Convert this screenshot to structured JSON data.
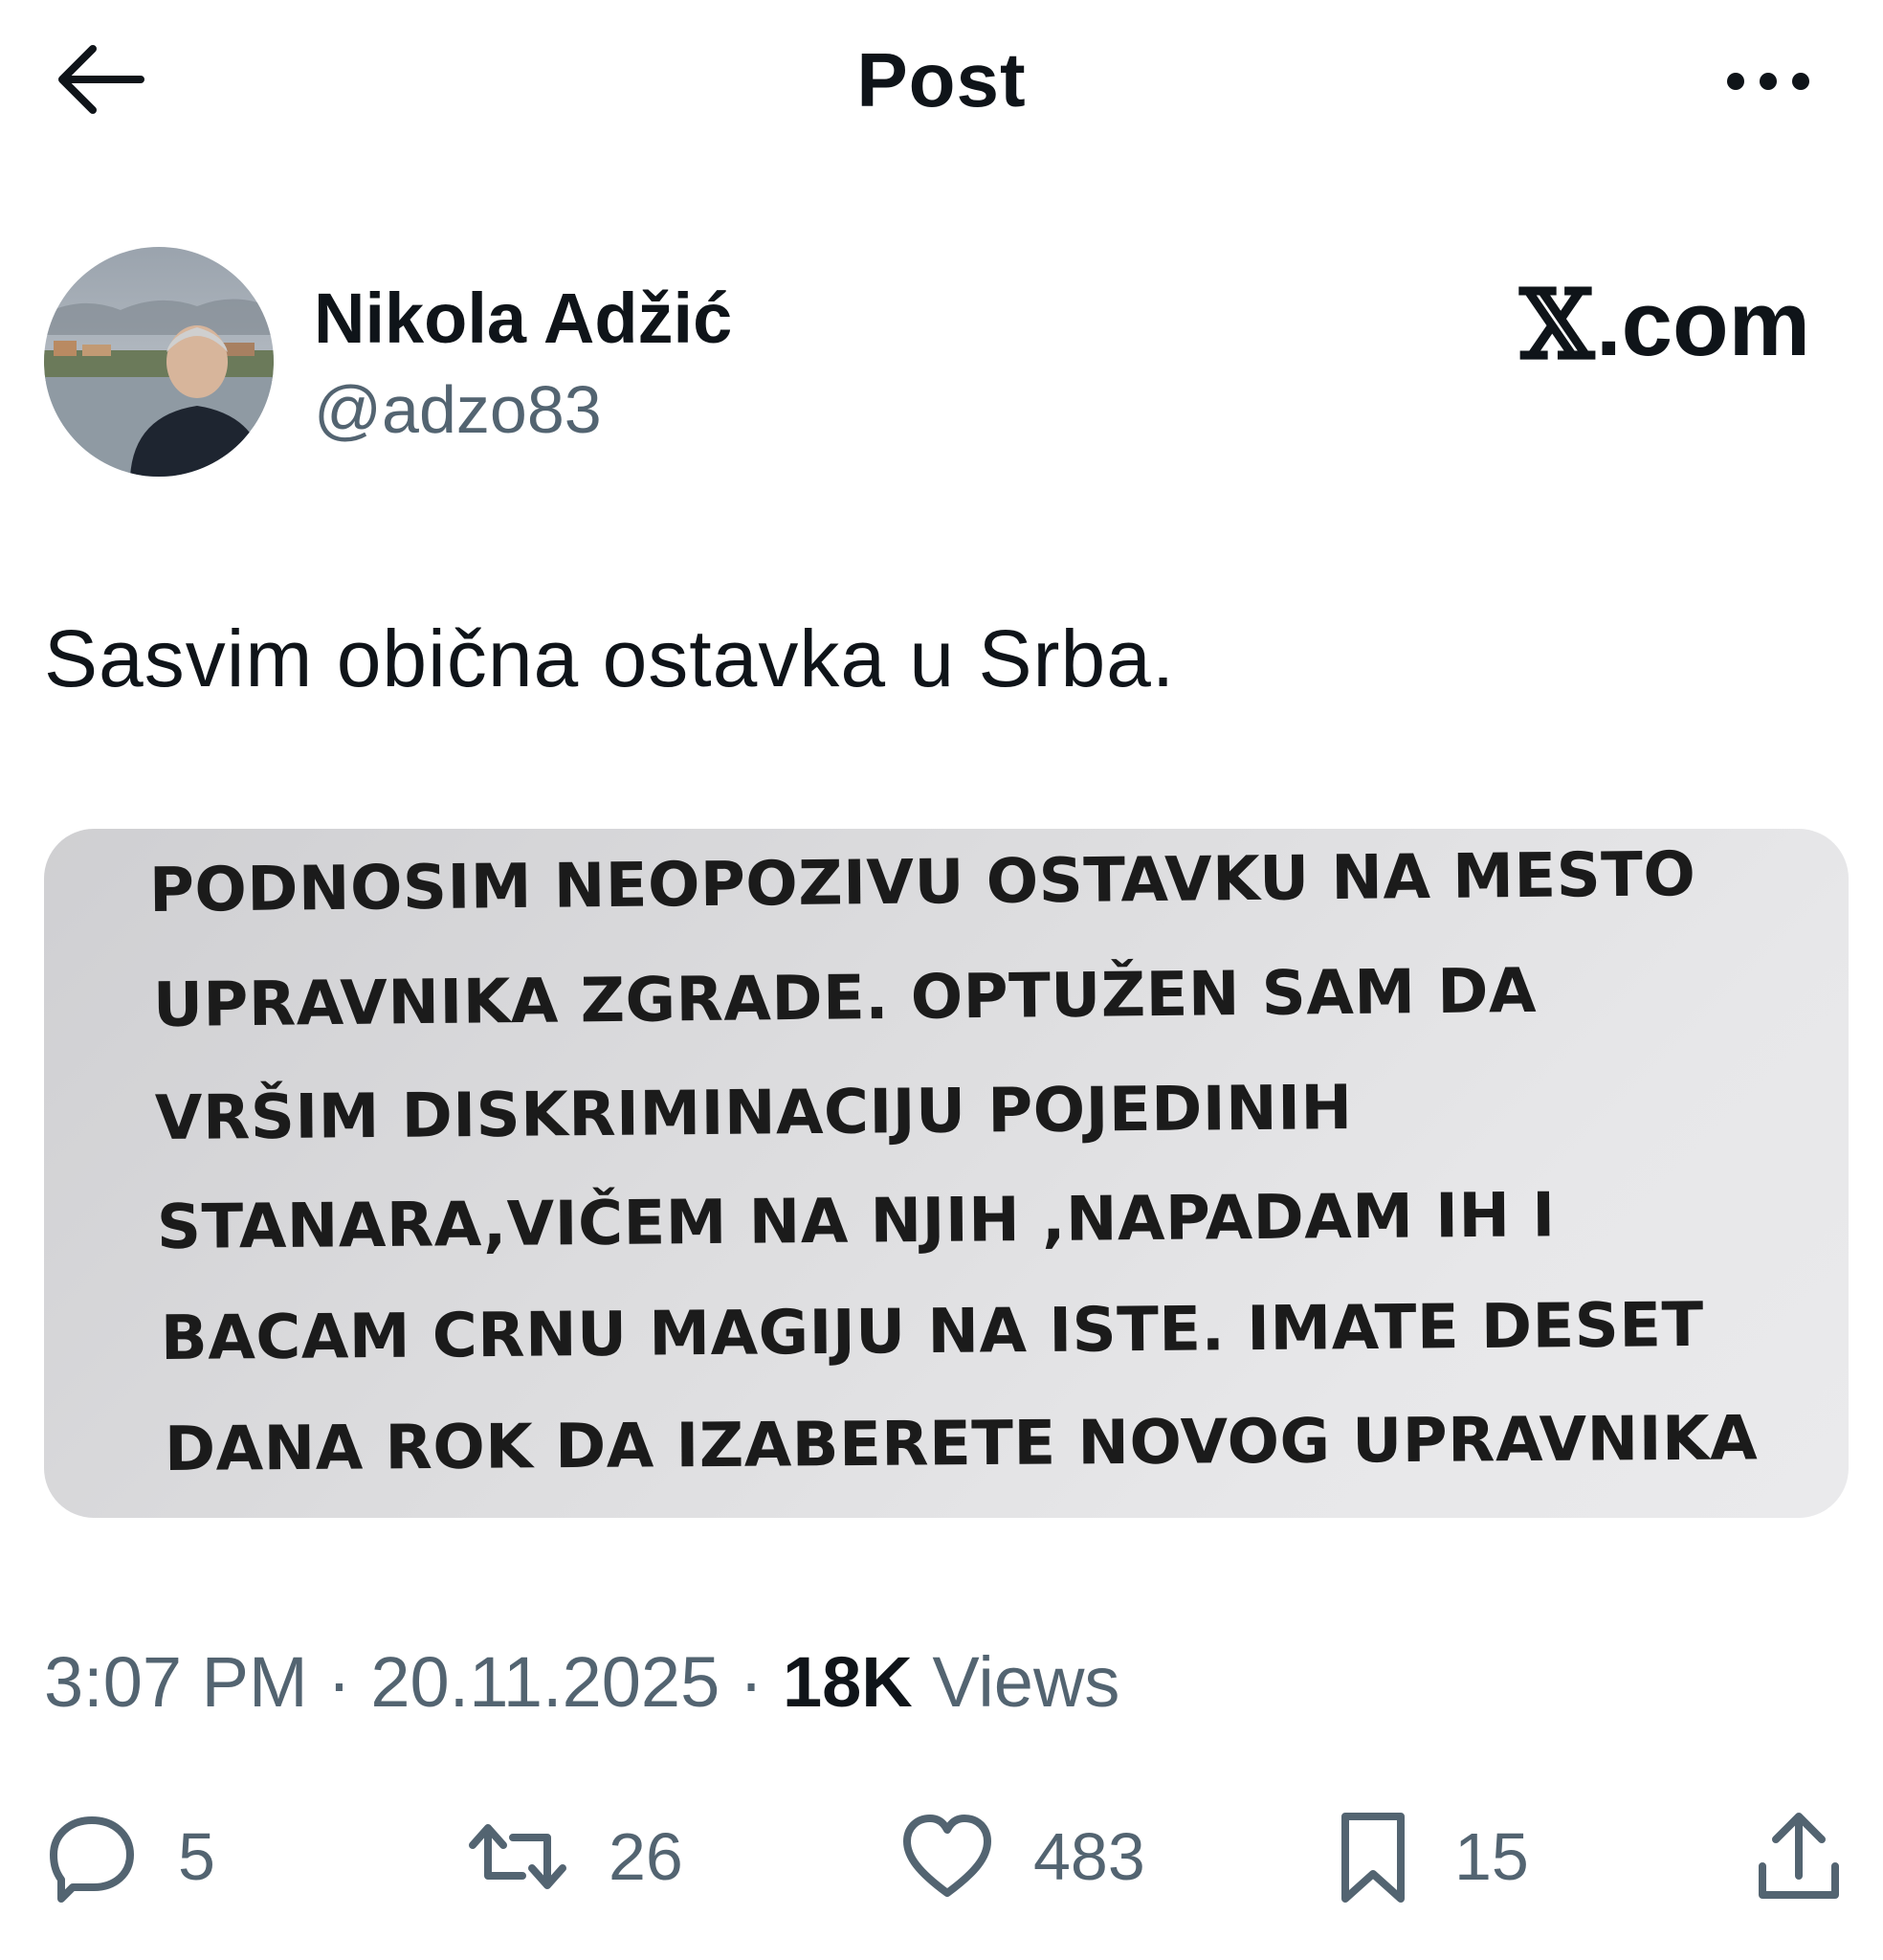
{
  "header": {
    "title": "Post",
    "back_icon": "arrow-left-icon",
    "more_icon": "more-horizontal-icon"
  },
  "author": {
    "display_name": "Nikola Adžić",
    "handle": "@adzo83",
    "brand_label": ".com"
  },
  "post": {
    "text": "Sasvim obična ostavka u Srba.",
    "image_text_lines": [
      "PODNOSIM NEOPOZIVU OSTAVKU NA MESTO",
      "UPRAVNIKA ZGRADE. OPTUŽEN SAM DA",
      "VRŠIM DISKRIMINACIJU POJEDINIH",
      "STANARA,VIČEM NA NJIH ,NAPADAM IH I",
      "BACAM CRNU MAGIJU NA ISTE. IMATE DESET",
      "DANA ROK DA IZABERETE NOVOG UPRAVNIKA"
    ]
  },
  "meta": {
    "time": "3:07 PM",
    "separator": " · ",
    "date": "20.11.2025",
    "views_count": "18K",
    "views_label": " Views"
  },
  "actions": {
    "replies": "5",
    "reposts": "26",
    "likes": "483",
    "bookmarks": "15"
  },
  "colors": {
    "text": "#0f1419",
    "secondary": "#536471",
    "background": "#ffffff"
  }
}
